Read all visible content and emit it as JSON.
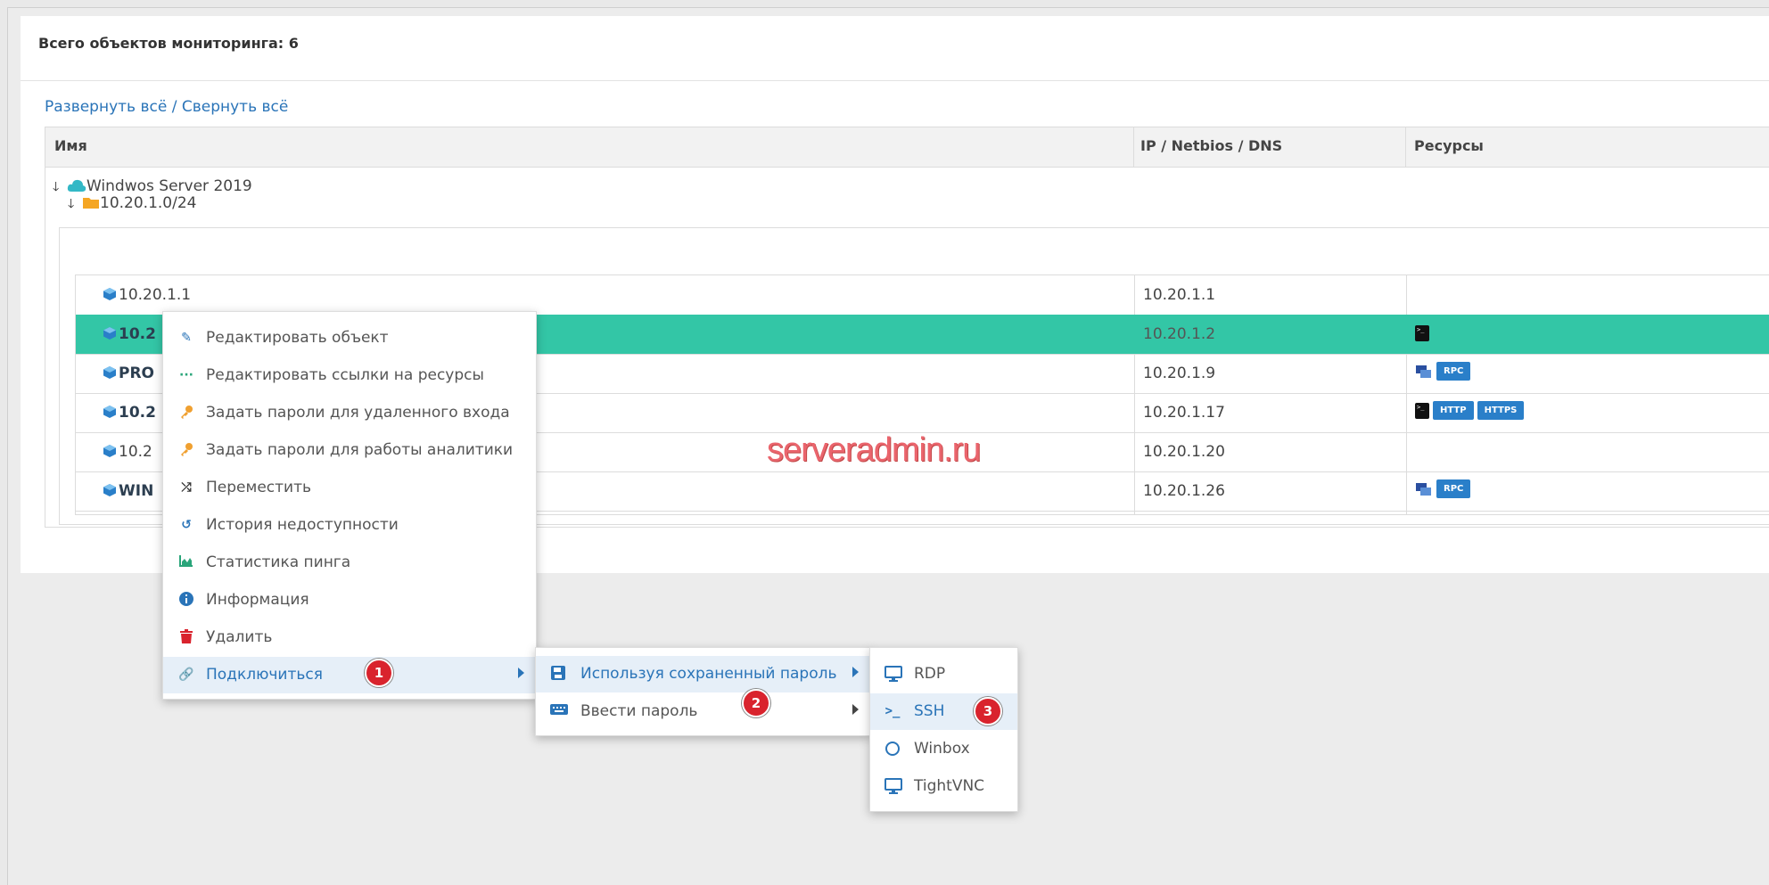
{
  "panel": {
    "title": "Всего объектов мониторинга: 6",
    "expand_all": "Развернуть всё",
    "separator": " / ",
    "collapse_all": "Свернуть всё"
  },
  "table": {
    "headers": {
      "name": "Имя",
      "ip": "IP / Netbios / DNS",
      "resources": "Ресурсы"
    },
    "group": {
      "name": "Windwos Server 2019"
    },
    "subgroup": {
      "name": "10.20.1.0/24"
    },
    "rows": [
      {
        "name": "10.20.1.1",
        "ip": "10.20.1.1",
        "bold": false,
        "selected": false,
        "resources": []
      },
      {
        "name": "10.2",
        "ip": "10.20.1.2",
        "bold": true,
        "selected": true,
        "resources": [
          "ssh-icon"
        ]
      },
      {
        "name": "PRO",
        "ip": "10.20.1.9",
        "bold": true,
        "selected": false,
        "resources": [
          "rdp-icon",
          "RPC"
        ]
      },
      {
        "name": "10.2",
        "ip": "10.20.1.17",
        "bold": true,
        "selected": false,
        "resources": [
          "ssh-icon",
          "HTTP",
          "HTTPS"
        ]
      },
      {
        "name": "10.2",
        "ip": "10.20.1.20",
        "bold": false,
        "selected": false,
        "resources": []
      },
      {
        "name": "WIN",
        "ip": "10.20.1.26",
        "bold": true,
        "selected": false,
        "resources": [
          "rdp-icon",
          "RPC"
        ]
      }
    ]
  },
  "watermark": "serveradmin.ru",
  "context_menu": {
    "items": [
      {
        "label": "Редактировать объект",
        "icon": "pencil-icon",
        "color": "#2a74b8"
      },
      {
        "label": "Редактировать ссылки на ресурсы",
        "icon": "dots-icon",
        "color": "#2aa57a"
      },
      {
        "label": "Задать пароли для удаленного входа",
        "icon": "key-icon",
        "color": "#f0a030"
      },
      {
        "label": "Задать пароли для работы аналитики",
        "icon": "key-icon",
        "color": "#f0a030"
      },
      {
        "label": "Переместить",
        "icon": "shuffle-icon",
        "color": "#333333"
      },
      {
        "label": "История недоступности",
        "icon": "history-icon",
        "color": "#2a74b8"
      },
      {
        "label": "Статистика пинга",
        "icon": "area-chart-icon",
        "color": "#2aa57a"
      },
      {
        "label": "Информация",
        "icon": "info-icon",
        "color": "#2a74b8"
      },
      {
        "label": "Удалить",
        "icon": "trash-icon",
        "color": "#d9232d"
      },
      {
        "label": "Подключиться",
        "icon": "link-icon",
        "color": "#2a74b8"
      }
    ]
  },
  "connect_menu": {
    "items": [
      {
        "label": "Используя сохраненный пароль",
        "icon": "save-icon"
      },
      {
        "label": "Ввести пароль",
        "icon": "keyboard-icon"
      }
    ]
  },
  "protocol_menu": {
    "items": [
      {
        "label": "RDP",
        "icon": "monitor-icon"
      },
      {
        "label": "SSH",
        "icon": "terminal-icon"
      },
      {
        "label": "Winbox",
        "icon": "circle-icon"
      },
      {
        "label": "TightVNC",
        "icon": "monitor-icon"
      }
    ]
  },
  "markers": [
    "1",
    "2",
    "3"
  ]
}
